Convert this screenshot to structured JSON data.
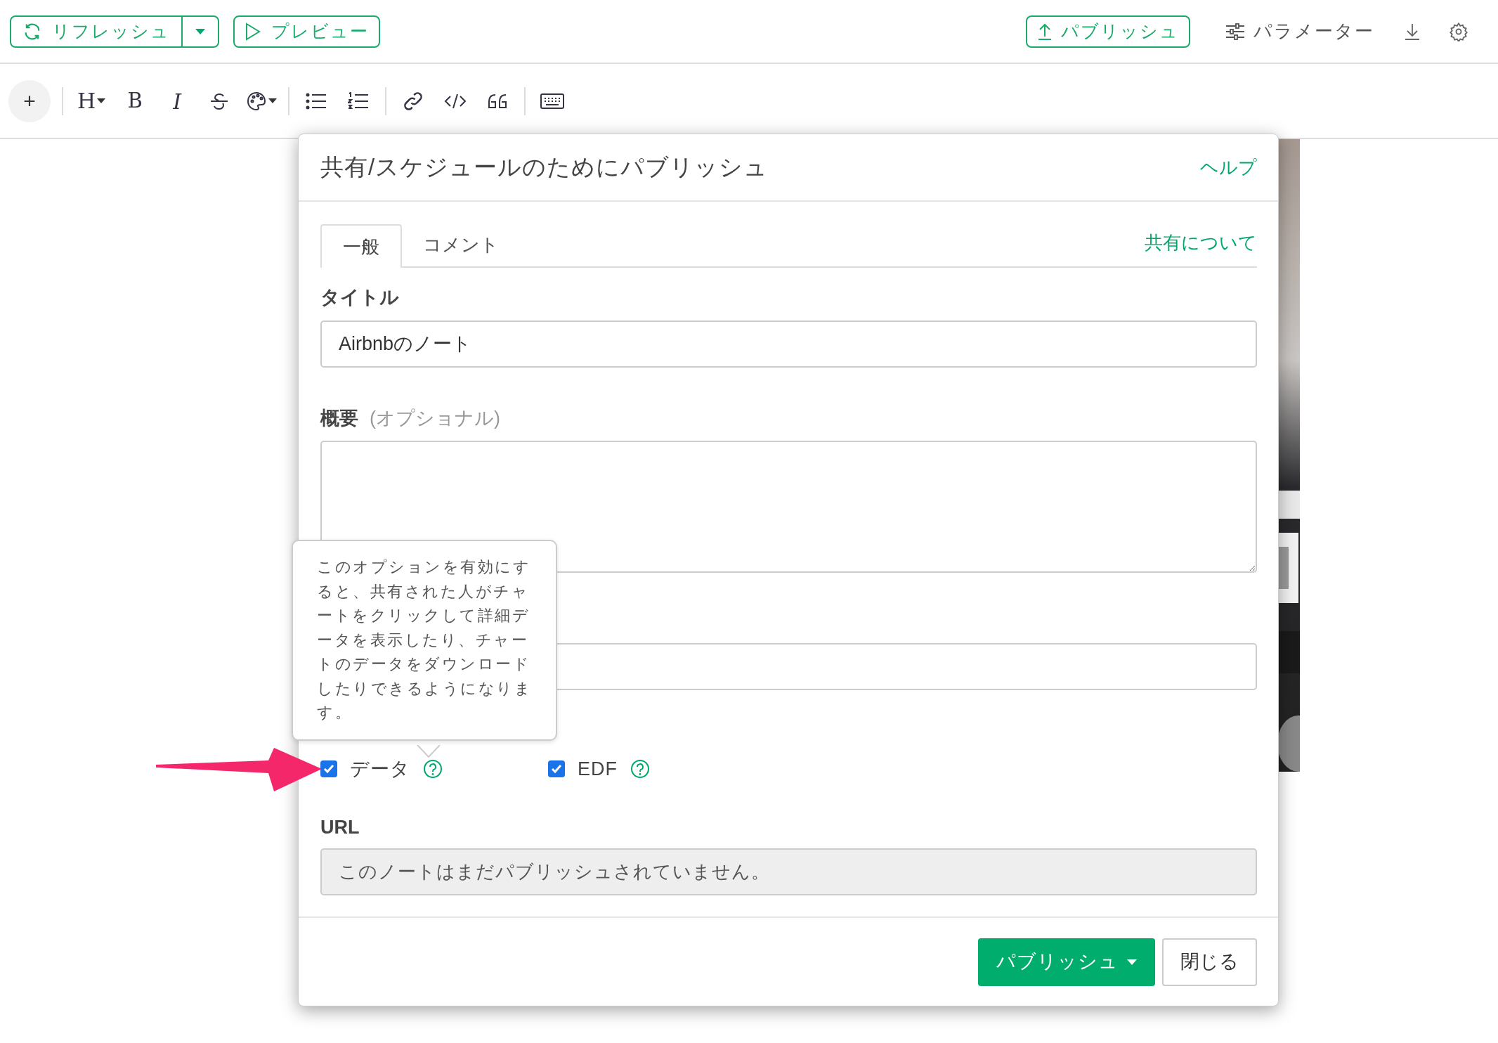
{
  "top_bar": {
    "refresh_button": "リフレッシュ",
    "preview_button": "プレビュー",
    "publish_button": "パブリッシュ",
    "parameters_button": "パラメーター"
  },
  "editor_toolbar": {
    "add_button": "+",
    "heading_button": "H",
    "bold_button": "B",
    "italic_button": "I"
  },
  "dialog": {
    "title": "共有/スケジュールのためにパブリッシュ",
    "help_link": "ヘルプ",
    "tabs": [
      {
        "label": "一般",
        "selected": true
      },
      {
        "label": "コメント",
        "selected": false
      }
    ],
    "about_link": "共有について",
    "title_label": "タイトル",
    "title_value": "Airbnbのノート",
    "summary_label": "概要",
    "summary_hint": "(オプショナル)",
    "tooltip": "このオプションを有効にすると、共有された人がチャートをクリックして詳細データを表示したり、チャートのデータをダウンロードしたりできるようになります。",
    "options": [
      {
        "label": "データ",
        "checked": true
      },
      {
        "label": "EDF",
        "checked": true
      }
    ],
    "url_label": "URL",
    "url_field": {
      "value": "このノートはまだパブリッシュされていません。",
      "disabled": true
    },
    "publish_button": "パブリッシュ",
    "close_button": "閉じる"
  }
}
